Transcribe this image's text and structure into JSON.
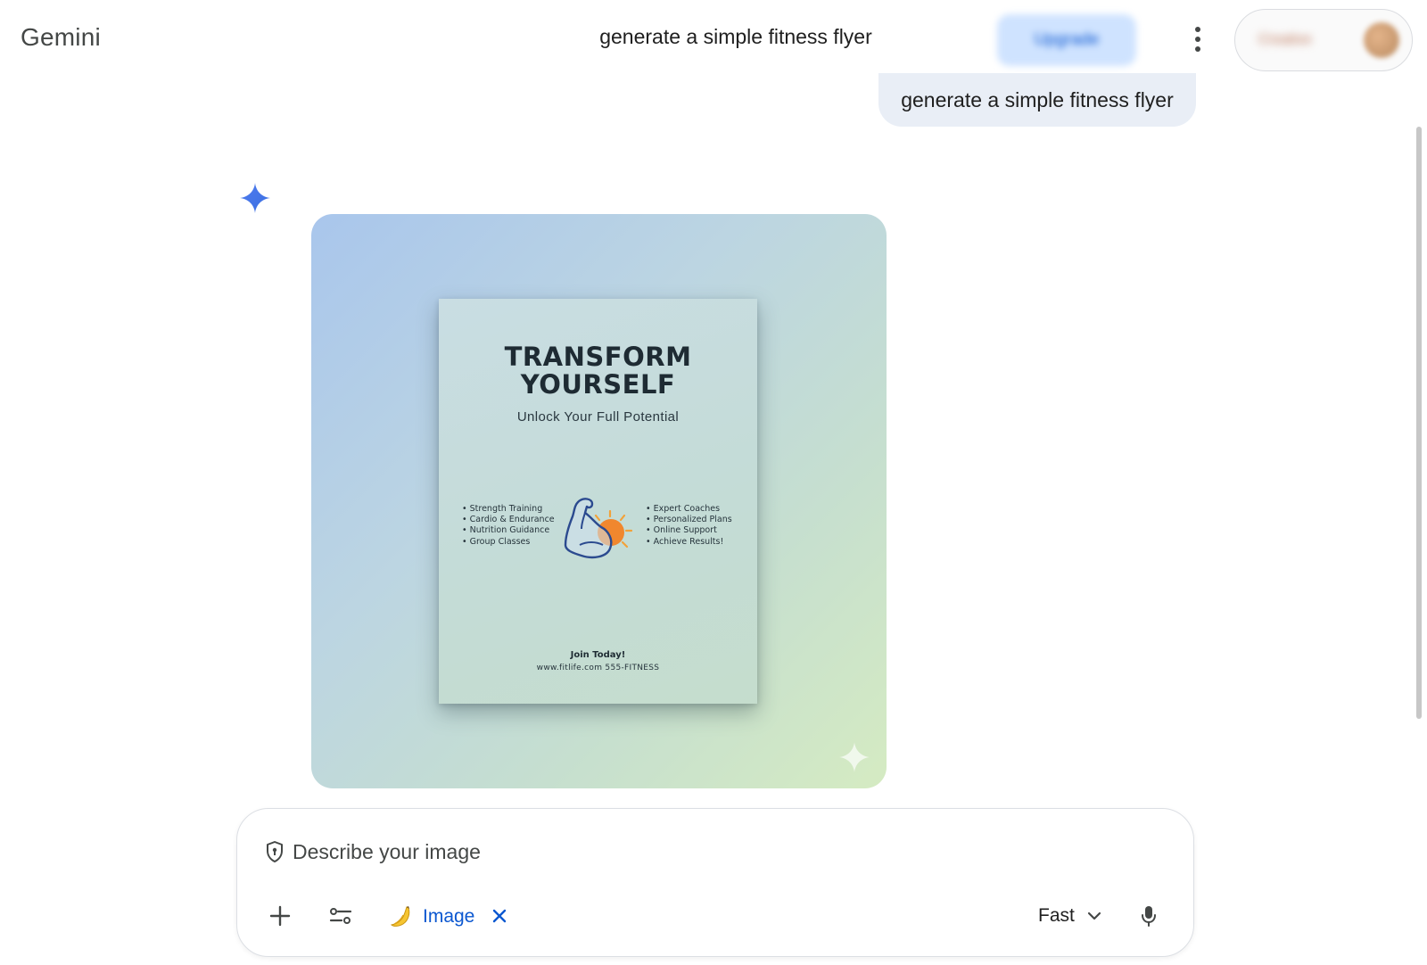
{
  "header": {
    "brand": "Gemini",
    "conversation_title": "generate a simple fitness flyer",
    "upgrade_button_label": "Upgrade",
    "account_name": "Creative",
    "icons": {
      "more": "more-vert-icon",
      "avatar": "avatar"
    }
  },
  "chat": {
    "user_prompt": "generate a simple fitness flyer",
    "response_icon": "gemini-spark-icon"
  },
  "generated_image": {
    "flyer": {
      "title_line1": "TRANSFORM",
      "title_line2": "YOURSELF",
      "subtitle": "Unlock Your Full Potential",
      "features_left": [
        "Strength Training",
        "Cardio & Endurance",
        "Nutrition Guidance",
        "Group Classes"
      ],
      "features_right": [
        "Expert Coaches",
        "Personalized Plans",
        "Online Support",
        "Achieve Results!"
      ],
      "cta": "Join Today!",
      "contact": "www.fitlife.com  555-FITNESS",
      "icon": "flexed-arm-sun-icon"
    },
    "colors": {
      "gradient_start": "#a9c6ec",
      "gradient_end": "#d5ebc2"
    }
  },
  "input": {
    "placeholder": "Describe your image",
    "tool_chip_label": "Image",
    "mode_label": "Fast",
    "icons": [
      "shield-icon",
      "plus-icon",
      "tune-icon",
      "banana-icon",
      "close-icon",
      "chevron-down-icon",
      "mic-icon"
    ]
  },
  "colors": {
    "accent": "#0b57d0",
    "bubble": "#e9eef6",
    "text": "#1f1f1f"
  }
}
